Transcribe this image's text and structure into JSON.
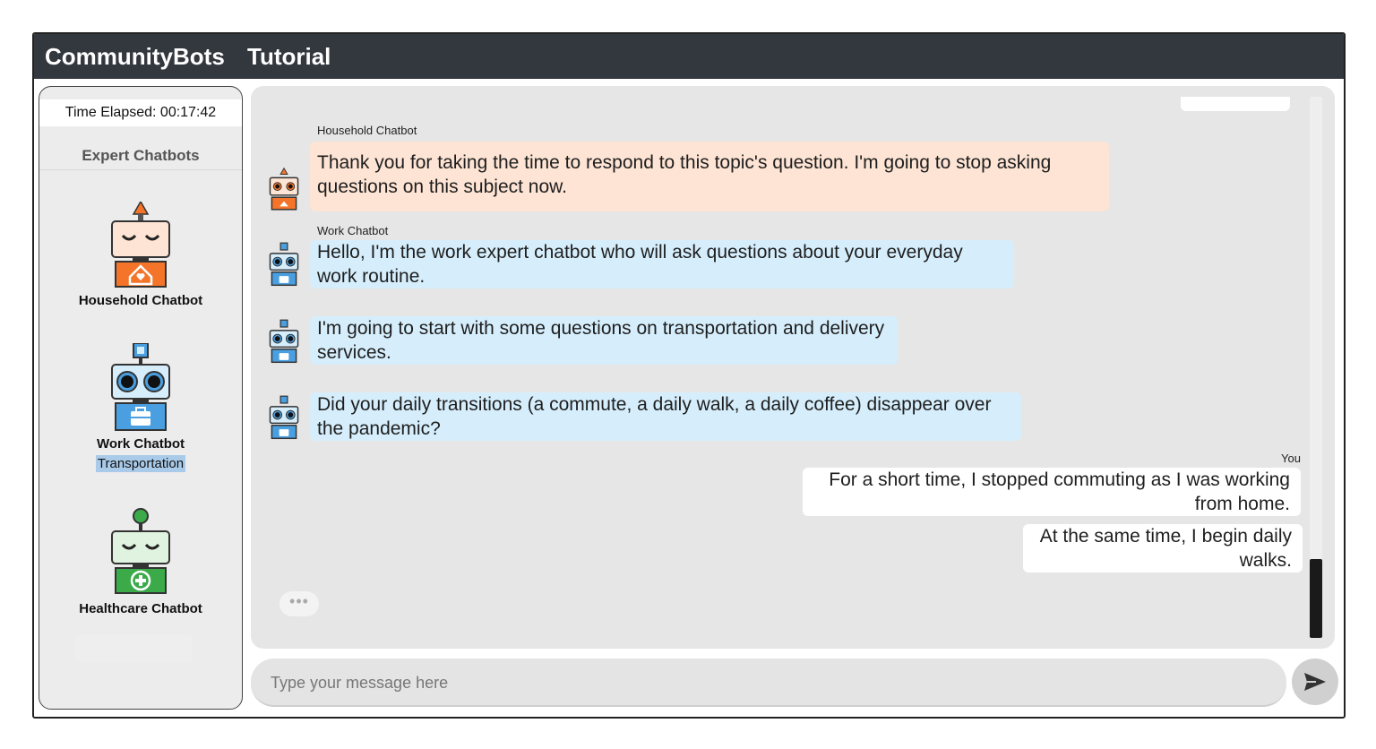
{
  "header": {
    "app_name": "CommunityBots",
    "tab": "Tutorial"
  },
  "sidebar": {
    "timer": "Time Elapsed: 00:17:42",
    "heading": "Expert Chatbots",
    "bots": [
      {
        "name": "Household Chatbot",
        "color": "#f4742a"
      },
      {
        "name": "Work Chatbot",
        "topic": "Transportation",
        "color": "#4a9fe0"
      },
      {
        "name": "Healthcare Chatbot",
        "color": "#3bab4a"
      }
    ]
  },
  "chat": {
    "messages": [
      {
        "sender": "Household Chatbot",
        "text": "Thank you for taking the time to respond to this topic's question. I'm going to stop asking questions on this subject now."
      },
      {
        "sender": "Work Chatbot",
        "text": "Hello, I'm the work expert chatbot who will ask questions about your everyday work routine."
      },
      {
        "text": "I'm going to start with some questions on transportation and delivery services."
      },
      {
        "text": "Did your daily transitions (a commute, a daily walk, a daily coffee) disappear over the pandemic?"
      },
      {
        "sender": "You",
        "text": "For a short time, I stopped commuting as I was working from home."
      },
      {
        "text": "At the same time, I begin daily walks."
      }
    ],
    "typing_indicator": "•••"
  },
  "composer": {
    "placeholder": "Type your message here"
  },
  "icons": {
    "send": "send-arrow-icon"
  }
}
